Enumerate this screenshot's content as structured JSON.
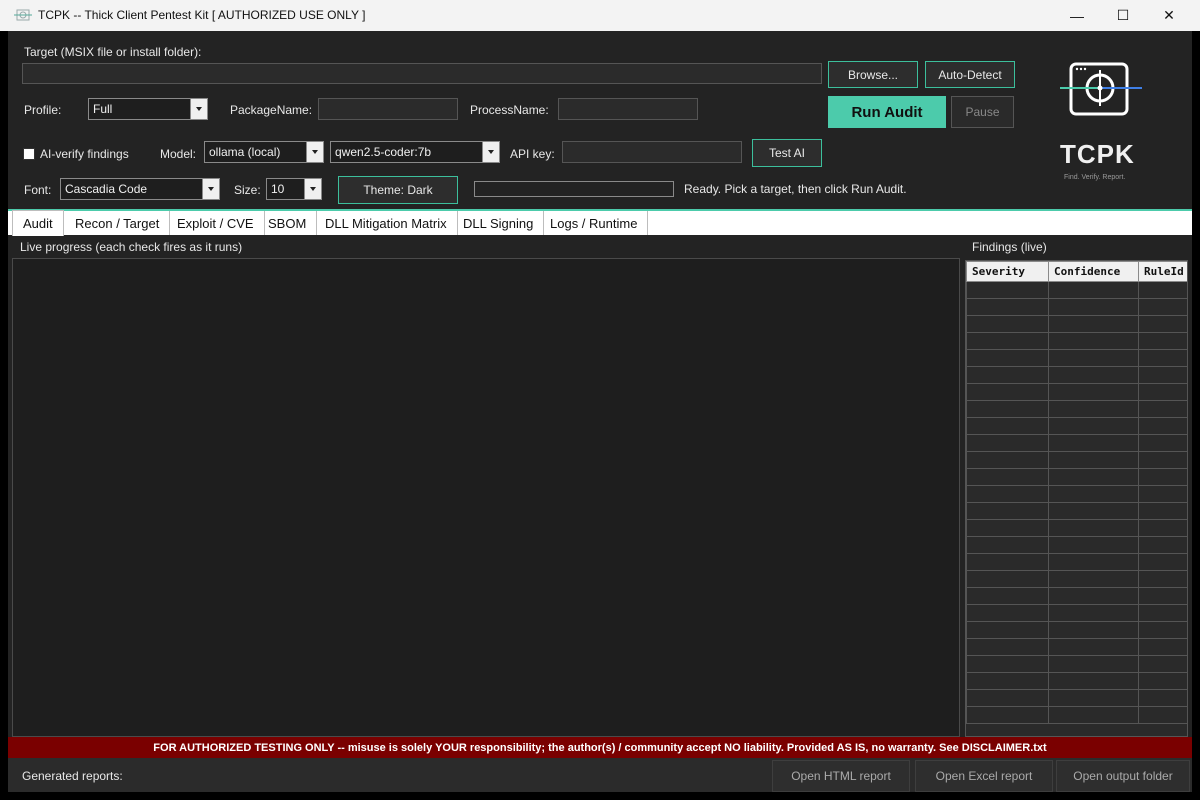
{
  "window": {
    "title": "TCPK -- Thick Client Pentest Kit   [ AUTHORIZED USE ONLY ]",
    "minimize": "—",
    "maximize": "☐",
    "close": "✕"
  },
  "target": {
    "label": "Target (MSIX file or install folder):",
    "value": "",
    "browse": "Browse...",
    "auto_detect": "Auto-Detect"
  },
  "profile": {
    "label": "Profile:",
    "value": "Full",
    "package_label": "PackageName:",
    "package_value": "",
    "process_label": "ProcessName:",
    "process_value": ""
  },
  "actions": {
    "run_audit": "Run Audit",
    "pause": "Pause"
  },
  "ai": {
    "verify_label": "AI-verify findings",
    "verify_checked": false,
    "model_label": "Model:",
    "model_value": "ollama (local)",
    "model_name": "qwen2.5-coder:7b",
    "api_key_label": "API key:",
    "api_key_value": "",
    "test_button": "Test AI"
  },
  "font": {
    "label": "Font:",
    "value": "Cascadia Code",
    "size_label": "Size:",
    "size_value": "10",
    "theme_button": "Theme: Dark"
  },
  "status": {
    "message": "Ready. Pick a target, then click Run Audit.",
    "progress": 0
  },
  "logo": {
    "text": "TCPK",
    "tagline": "Find. Verify. Report.",
    "icon": "crosshair-window-icon"
  },
  "tabs": [
    {
      "label": "Audit"
    },
    {
      "label": "Recon / Target"
    },
    {
      "label": "Exploit / CVE"
    },
    {
      "label": "SBOM"
    },
    {
      "label": "DLL Mitigation Matrix"
    },
    {
      "label": "DLL Signing"
    },
    {
      "label": "Logs / Runtime"
    }
  ],
  "live_progress": {
    "label": "Live progress (each check fires as it runs)"
  },
  "findings": {
    "label": "Findings (live)",
    "columns": [
      "Severity",
      "Confidence",
      "RuleId"
    ]
  },
  "disclaimer": "FOR AUTHORIZED TESTING ONLY  --  misuse is solely YOUR responsibility; the author(s) / community accept NO liability.  Provided AS IS, no warranty.  See DISCLAIMER.txt",
  "footer": {
    "label": "Generated reports:",
    "open_html": "Open HTML report",
    "open_excel": "Open Excel report",
    "open_folder": "Open output folder"
  },
  "colors": {
    "accent": "#4ccbab",
    "banner": "#7a0000",
    "background": "#232323"
  }
}
